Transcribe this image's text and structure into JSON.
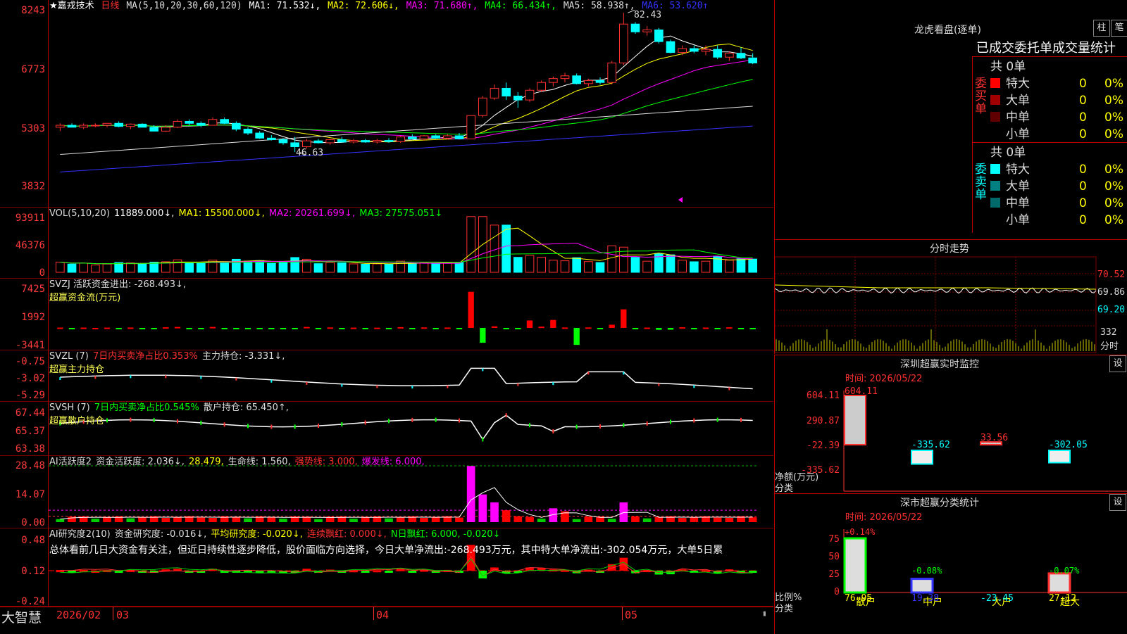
{
  "main": {
    "title": "★嘉戎技术",
    "period": "日线",
    "ma_header": "MA(5,10,20,30,60,120)",
    "ma_values": [
      {
        "label": "MA1: 71.532↓,",
        "color": "#ffffff"
      },
      {
        "label": "MA2: 72.606↓,",
        "color": "#ffff00"
      },
      {
        "label": "MA3: 71.680↑,",
        "color": "#ff00ff"
      },
      {
        "label": "MA4: 66.434↑,",
        "color": "#00ff00"
      },
      {
        "label": "MA5: 58.938↑,",
        "color": "#dddddd"
      },
      {
        "label": "MA6: 53.620↑",
        "color": "#3333ff"
      }
    ],
    "yticks": [
      "8243",
      "6773",
      "5303",
      "3832"
    ],
    "high_label": "82.43",
    "low_label": "46.63"
  },
  "vol": {
    "header": [
      {
        "label": "VOL(5,10,20)",
        "color": "#dddddd"
      },
      {
        "label": "11889.000↓,",
        "color": "#ffffff"
      },
      {
        "label": "MA1: 15500.000↓,",
        "color": "#ffff00"
      },
      {
        "label": "MA2: 20261.699↓,",
        "color": "#ff00ff"
      },
      {
        "label": "MA3: 27575.051↓",
        "color": "#00ff00"
      }
    ],
    "yticks": [
      "93911",
      "46376",
      "0"
    ]
  },
  "svzj": {
    "header": [
      {
        "label": "SVZJ  活跃资金进出: -268.493↓,",
        "color": "#dddddd"
      }
    ],
    "sub": "超赢资金流(万元)",
    "yticks": [
      "7425",
      "1992",
      "-3441"
    ]
  },
  "svzl": {
    "header": [
      {
        "label": "SVZL (7)",
        "color": "#dddddd"
      },
      {
        "label": "7日内买卖净占比0.353%",
        "color": "#ff3030"
      },
      {
        "label": "主力持仓: -3.331↓,",
        "color": "#dddddd"
      }
    ],
    "sub": "超赢主力持仓",
    "yticks": [
      "-0.75",
      "-3.02",
      "-5.29"
    ]
  },
  "svsh": {
    "header": [
      {
        "label": "SVSH (7)",
        "color": "#dddddd"
      },
      {
        "label": "7日内买卖净占比0.545%",
        "color": "#00ff00"
      },
      {
        "label": "散户持仓: 65.450↑,",
        "color": "#dddddd"
      }
    ],
    "sub": "超赢散户持仓",
    "yticks": [
      "67.44",
      "65.37",
      "63.38"
    ]
  },
  "ai1": {
    "header": [
      {
        "label": "AI活跃度2",
        "color": "#dddddd"
      },
      {
        "label": "资金活跃度: 2.036↓,",
        "color": "#dddddd"
      },
      {
        "label": "28.479,",
        "color": "#ffff00"
      },
      {
        "label": "生命线: 1.560,",
        "color": "#dddddd"
      },
      {
        "label": "强势线: 3.000,",
        "color": "#ff3030"
      },
      {
        "label": "爆发线: 6.000,",
        "color": "#ff00ff"
      }
    ],
    "yticks": [
      "28.48",
      "14.07",
      "0.00"
    ]
  },
  "ai2": {
    "header": [
      {
        "label": "AI研究度2(10)",
        "color": "#dddddd"
      },
      {
        "label": "资金研究度: -0.016↓,",
        "color": "#dddddd"
      },
      {
        "label": "平均研究度: -0.020↓,",
        "color": "#ffff00"
      },
      {
        "label": "连续飘红: 0.000↓,",
        "color": "#ff3030"
      },
      {
        "label": "N日飘红: 6.000, -0.020↓",
        "color": "#00ff00"
      }
    ],
    "comment": "总体看前几日大资金有关注，但近日持续性逐步降低，股价面临方向选择，今日大单净流出:-268.493万元，其中特大单净流出:-302.054万元，大单5日累",
    "yticks": [
      "0.48",
      "0.12",
      "-0.24"
    ]
  },
  "bottom": {
    "brand": "大智慧",
    "dates": [
      "2026/02",
      "03",
      "04",
      "05"
    ]
  },
  "lhb": {
    "title": "龙虎看盘(逐单)",
    "btn1": "柱",
    "btn2": "笔",
    "heading": "已成交委托单成交量统计",
    "buy_label": "委买单",
    "sell_label": "委卖单",
    "buy_total": "共 0单",
    "sell_total": "共 0单",
    "buy_rows": [
      {
        "name": "特大",
        "count": "0",
        "pct": "0%",
        "color": "#ff0000"
      },
      {
        "name": "大单",
        "count": "0",
        "pct": "0%",
        "color": "#a00000"
      },
      {
        "name": "中单",
        "count": "0",
        "pct": "0%",
        "color": "#600000"
      },
      {
        "name": "小单",
        "count": "0",
        "pct": "0%",
        "color": "#000000"
      }
    ],
    "sell_rows": [
      {
        "name": "特大",
        "count": "0",
        "pct": "0%",
        "color": "#00ffff"
      },
      {
        "name": "大单",
        "count": "0",
        "pct": "0%",
        "color": "#008080"
      },
      {
        "name": "中单",
        "count": "0",
        "pct": "0%",
        "color": "#006a6a"
      },
      {
        "name": "小单",
        "count": "0",
        "pct": "0%",
        "color": "#000000"
      }
    ]
  },
  "fenshi": {
    "title": "分时走势",
    "yticks": [
      "70.52",
      "69.86",
      "69.20"
    ],
    "vol_label": "332",
    "unit": "分时"
  },
  "sz_monitor": {
    "title": "深圳超赢实时监控",
    "btn": "设",
    "time": "时间: 2026/05/22",
    "yticks": [
      "604.11",
      "290.87",
      "-22.39",
      "-335.62"
    ],
    "ylabel1": "净额(万元)",
    "ylabel2": "分类",
    "categories": [
      "散户",
      "中户",
      "大户",
      "超大"
    ],
    "values": [
      604.11,
      -335.62,
      33.56,
      -302.05
    ],
    "value_labels": [
      "604.11",
      "-335.62",
      "33.56",
      "-302.05"
    ]
  },
  "sz_stats": {
    "title": "深市超赢分类统计",
    "btn": "设",
    "time": "时间: 2026/05/22",
    "yticks": [
      "75",
      "50",
      "25",
      "0"
    ],
    "ylabel1": "比例%",
    "ylabel2": "分类",
    "categories": [
      "散户",
      "中户",
      "大户",
      "超大"
    ],
    "changes": [
      "+0.14%",
      "-0.08%",
      "",
      "-0.07%"
    ],
    "values": [
      76.95,
      19.38,
      -23.45,
      27.12
    ],
    "value_labels": [
      "76.95",
      "19.38",
      "-23.45",
      "27.12"
    ]
  },
  "chart_data": {
    "type": "candlestick",
    "title": "★嘉戎技术 日线",
    "x_dates": [
      "2026/02",
      "03",
      "04",
      "05"
    ],
    "ylim": [
      38.32,
      82.43
    ],
    "candles_approx": [
      [
        53,
        54,
        52,
        53.5
      ],
      [
        53.5,
        54,
        53,
        53
      ],
      [
        53,
        54,
        52.5,
        53.5
      ],
      [
        53.5,
        54,
        53,
        53.5
      ],
      [
        53.5,
        54,
        53,
        54
      ],
      [
        54,
        54.5,
        53,
        53.2
      ],
      [
        53.2,
        54,
        52.5,
        53.8
      ],
      [
        53.8,
        54,
        53,
        53
      ],
      [
        53,
        53.5,
        52,
        52
      ],
      [
        52,
        53.5,
        51.8,
        53
      ],
      [
        53,
        55,
        52.8,
        54.5
      ],
      [
        54.5,
        55,
        53.5,
        54
      ],
      [
        54,
        54.5,
        53,
        53.5
      ],
      [
        53.5,
        55.5,
        53.5,
        55
      ],
      [
        55,
        55.5,
        53.8,
        54
      ],
      [
        54,
        54.5,
        52,
        52.5
      ],
      [
        52.5,
        53,
        51,
        51.5
      ],
      [
        51.5,
        52,
        50,
        50.2
      ],
      [
        50.2,
        51,
        49.6,
        49.8
      ],
      [
        49.8,
        50.2,
        48.5,
        49
      ],
      [
        49,
        50.5,
        46.6,
        48
      ],
      [
        48,
        50,
        47.5,
        49.5
      ],
      [
        49.5,
        50,
        48.8,
        49
      ],
      [
        49,
        50,
        48.5,
        49.8
      ],
      [
        49.8,
        50.5,
        49,
        49.2
      ],
      [
        49.2,
        50,
        48.8,
        49.6
      ],
      [
        49.6,
        50,
        49,
        49.2
      ],
      [
        49.2,
        50,
        48.8,
        49.6
      ],
      [
        49.6,
        50.2,
        49,
        49.3
      ],
      [
        49.3,
        50.8,
        49,
        50.5
      ],
      [
        50.5,
        51.2,
        50,
        50
      ],
      [
        50,
        51,
        49.6,
        50.8
      ],
      [
        50.8,
        51.2,
        50,
        50.2
      ],
      [
        50.2,
        51.2,
        49.8,
        50.8
      ],
      [
        50.8,
        51.5,
        50,
        50
      ],
      [
        50,
        56,
        50,
        56
      ],
      [
        56,
        61,
        55.5,
        60.5
      ],
      [
        60.5,
        64,
        60,
        63
      ],
      [
        63,
        64.5,
        60,
        61
      ],
      [
        61,
        62,
        58,
        60
      ],
      [
        60,
        63,
        59.5,
        62.5
      ],
      [
        62.5,
        65,
        62,
        64.5
      ],
      [
        64.5,
        66,
        63.5,
        65.5
      ],
      [
        65.5,
        67,
        64.5,
        66.2
      ],
      [
        66.2,
        66.8,
        64,
        64.2
      ],
      [
        64.2,
        65.5,
        63.5,
        65
      ],
      [
        65,
        65.8,
        64,
        64.5
      ],
      [
        64.5,
        70,
        64,
        69.5
      ],
      [
        69.5,
        82.4,
        69,
        79.5
      ],
      [
        79.5,
        80,
        77,
        77.5
      ],
      [
        77.5,
        79,
        76.5,
        78
      ],
      [
        78,
        78.5,
        74.5,
        75
      ],
      [
        75,
        75.5,
        72,
        72.2
      ],
      [
        72.2,
        74,
        71.5,
        73.2
      ],
      [
        73.2,
        74,
        72,
        72.5
      ],
      [
        72.5,
        74,
        71.5,
        73
      ],
      [
        73,
        74,
        70.5,
        71
      ],
      [
        71,
        72.5,
        70,
        72
      ],
      [
        72,
        73.5,
        70.5,
        70.8
      ],
      [
        70.8,
        72,
        69.2,
        69.5
      ]
    ],
    "series": [
      {
        "name": "MA1",
        "color": "#ffffff"
      },
      {
        "name": "MA2",
        "color": "#ffff00"
      },
      {
        "name": "MA3",
        "color": "#ff00ff"
      },
      {
        "name": "MA4",
        "color": "#00ff00"
      },
      {
        "name": "MA5",
        "color": "#dddddd"
      },
      {
        "name": "MA6",
        "color": "#3333ff"
      }
    ],
    "grid": false,
    "legend": "top-left"
  }
}
